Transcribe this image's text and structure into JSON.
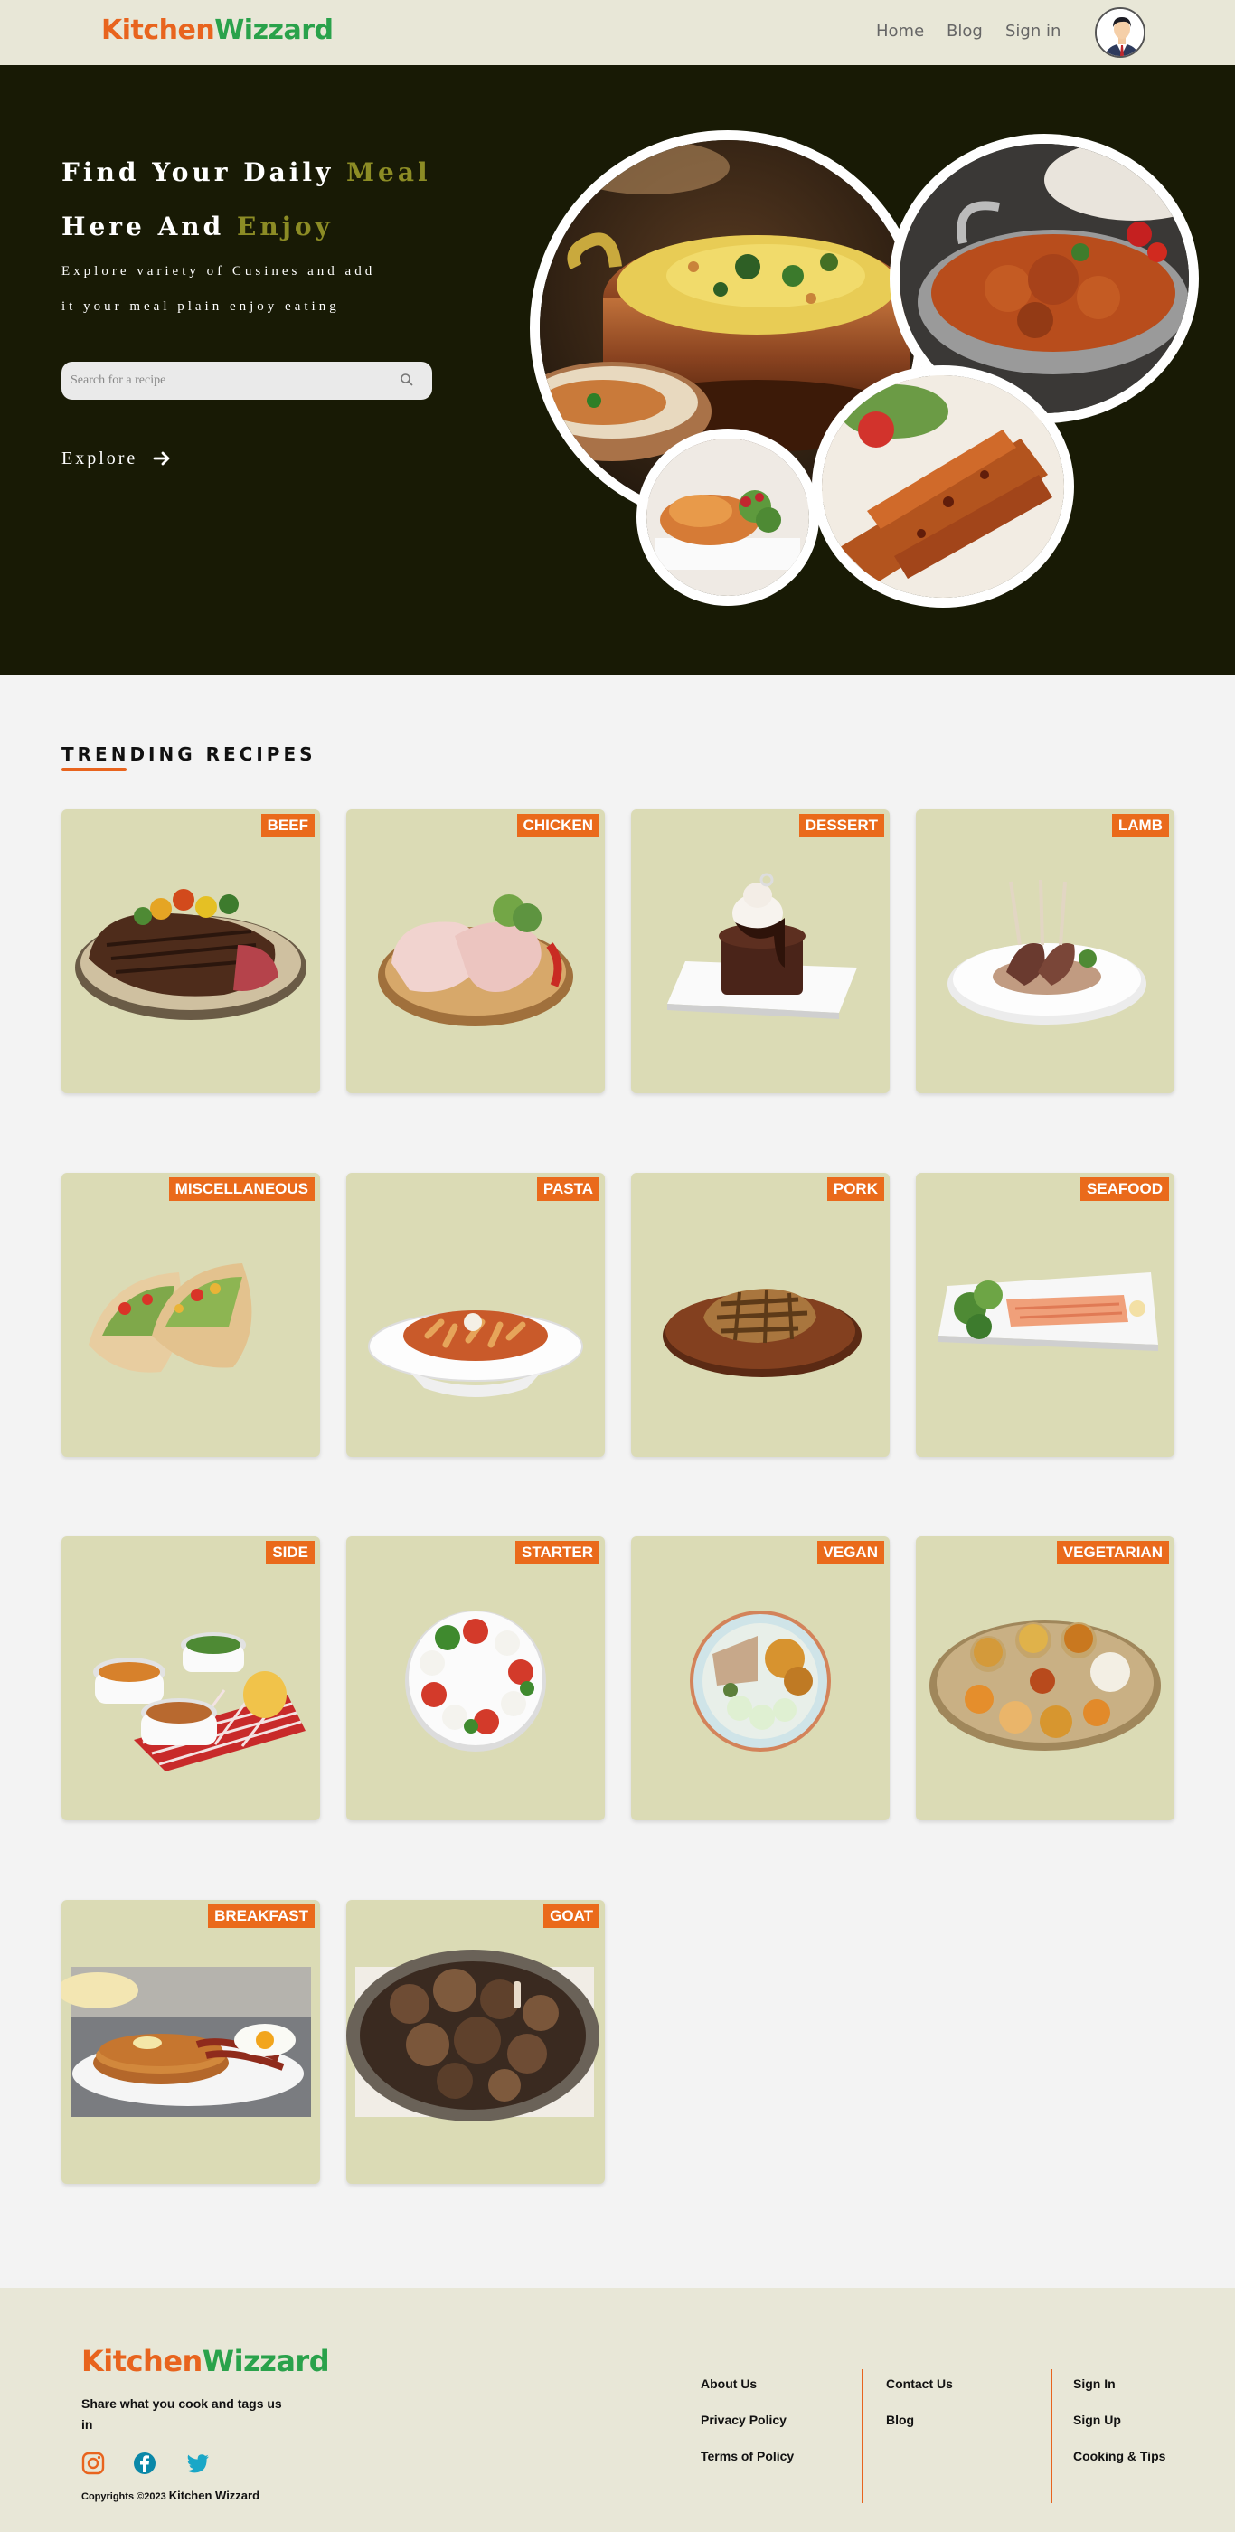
{
  "nav": {
    "logo_part1": "Kitchen",
    "logo_part2": "Wizzard",
    "links": [
      "Home",
      "Blog",
      "Sign in"
    ]
  },
  "hero": {
    "title_line1": "Find Your Daily ",
    "title_line1_highlight": "Meal",
    "title_line2": "Here And ",
    "title_line2_highlight": "Enjoy",
    "sub_line1": "Explore variety of Cusines and add",
    "sub_line2": "it your meal plain enjoy eating",
    "search_placeholder": "Search for a recipe",
    "explore_label": "Explore"
  },
  "trending": {
    "title": "TRENDING RECIPES",
    "categories": [
      "BEEF",
      "CHICKEN",
      "DESSERT",
      "LAMB",
      "MISCELLANEOUS",
      "PASTA",
      "PORK",
      "SEAFOOD",
      "SIDE",
      "STARTER",
      "VEGAN",
      "VEGETARIAN",
      "BREAKFAST",
      "GOAT"
    ]
  },
  "footer": {
    "logo_part1": "Kitchen",
    "logo_part2": "Wizzard",
    "tagline": "Share what you cook and tags us in",
    "copyright_prefix": "Copyrights ©2023 ",
    "copyright_name": "Kitchen Wizzard",
    "col1": [
      "About Us",
      "Privacy Policy",
      "Terms of Policy"
    ],
    "col2": [
      "Contact Us",
      "Blog"
    ],
    "col3": [
      "Sign In",
      "Sign Up",
      "Cooking & Tips"
    ]
  },
  "colors": {
    "accent": "#e8641e",
    "brand_green": "#2aa24b",
    "hero_bg": "#181a05",
    "card_bg": "#dbdbb5",
    "highlight": "#8c8c25"
  },
  "icons": [
    "search-icon",
    "arrow-right-icon",
    "instagram-icon",
    "facebook-icon",
    "twitter-icon",
    "avatar-icon"
  ]
}
